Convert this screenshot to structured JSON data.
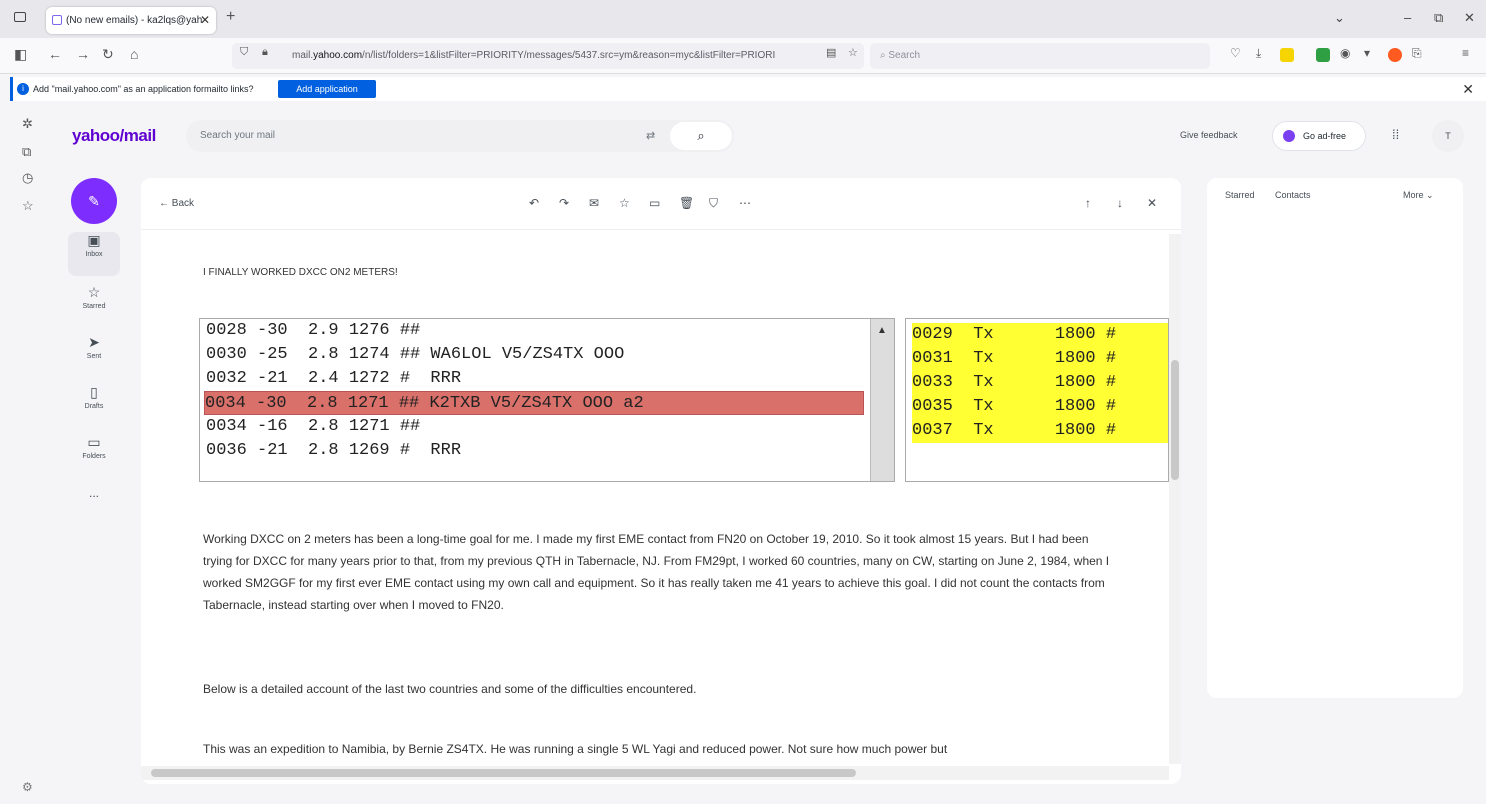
{
  "browser": {
    "tab_title": "(No new emails) - ka2lqs@yah",
    "tab_close": "✕",
    "new_tab": "+",
    "url_prefix": "mail.",
    "url_domain": "yahoo.com",
    "url_rest": "/n/list/folders=1&listFilter=PRIORITY/messages/5437.src=ym&reason=myc&listFilter=PRIORI",
    "search_placeholder": "Search",
    "window_controls": [
      "⌄",
      "–",
      "⧉",
      "✕"
    ]
  },
  "notification": {
    "text": "Add \"mail.yahoo.com\" as an application formailto links?",
    "button": "Add application",
    "close": "✕"
  },
  "yahoo": {
    "logo": "yahoo/mail",
    "search_placeholder": "Search your mail",
    "feedback": "Give feedback",
    "adfree": "Go ad-free",
    "avatar": "T",
    "nav": [
      {
        "label": "Inbox",
        "icon": "▣"
      },
      {
        "label": "Starred",
        "icon": "☆"
      },
      {
        "label": "Sent",
        "icon": "➤"
      },
      {
        "label": "Drafts",
        "icon": "▯"
      },
      {
        "label": "Folders",
        "icon": "▭"
      },
      {
        "label": "...",
        "icon": ""
      }
    ],
    "right_panel": {
      "starred": "Starred",
      "contacts": "Contacts",
      "more": "More ⌄"
    }
  },
  "message": {
    "back": "Back",
    "heading": "I FINALLY WORKED DXCC ON2 METERS!",
    "decode_rows": [
      "0028 -30  2.9 1276 ##",
      "0030 -25  2.8 1274 ## WA6LOL V5/ZS4TX OOO",
      "0032 -21  2.4 1272 #  RRR",
      "0034 -30  2.8 1271 ## K2TXB V5/ZS4TX OOO a2",
      "0034 -16  2.8 1271 ##",
      "0036 -21  2.8 1269 #  RRR"
    ],
    "tx_rows": [
      "0029  Tx      1800 #",
      "0031  Tx      1800 #",
      "0033  Tx      1800 #",
      "0035  Tx      1800 #",
      "0037  Tx      1800 #"
    ],
    "paragraphs": [
      "Working DXCC on 2 meters has been a long-time goal for me.  I made my first EME contact from FN20 on October 19, 2010.  So it took almost 15 years.  But I had been trying for DXCC for many years prior to that, from my previous QTH in Tabernacle, NJ.  From FM29pt, I worked 60 countries, many on CW, starting on June 2, 1984, when I worked SM2GGF for my first ever EME contact using my own call and equipment.  So it has really taken me 41 years to achieve this goal.  I did not count the contacts from Tabernacle, instead starting over when I moved to FN20.",
      "Below is a detailed account of the last two countries and some of the difficulties encountered.",
      "This was an expedition to Namibia, by Bernie ZS4TX.  He was running a single 5 WL Yagi and reduced power.  Not sure how much power but"
    ]
  }
}
